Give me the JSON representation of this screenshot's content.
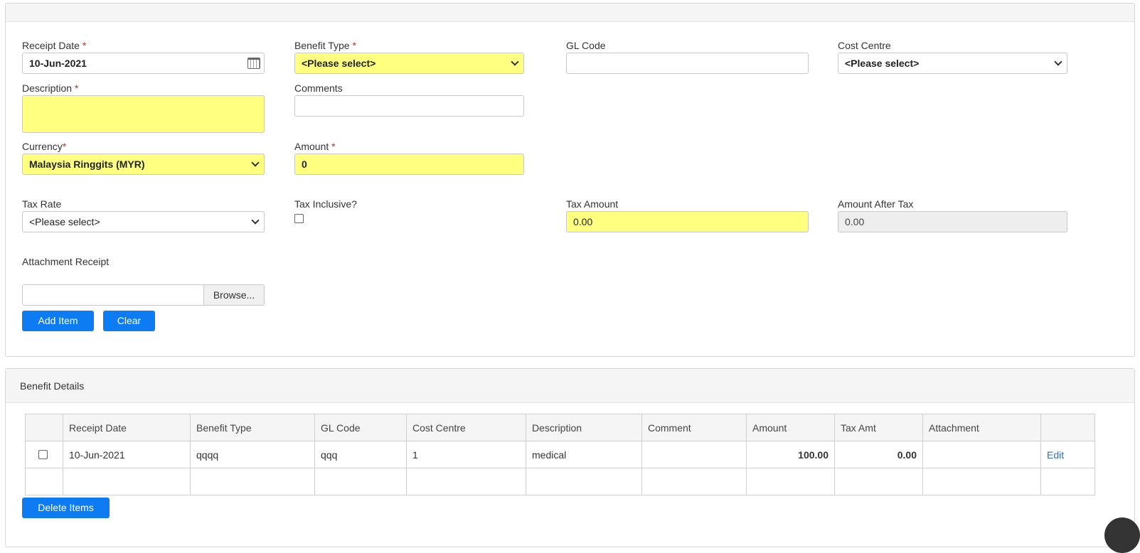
{
  "form": {
    "receipt_date_label": "Receipt Date",
    "receipt_date_value": "10-Jun-2021",
    "benefit_type_label": "Benefit Type",
    "benefit_type_value": "<Please select>",
    "gl_code_label": "GL Code",
    "gl_code_value": "",
    "cost_centre_label": "Cost Centre",
    "cost_centre_value": "<Please select>",
    "description_label": "Description",
    "description_value": "",
    "comments_label": "Comments",
    "comments_value": "",
    "currency_label": "Currency",
    "currency_value": "Malaysia Ringgits (MYR)",
    "amount_label": "Amount",
    "amount_value": "0",
    "tax_rate_label": "Tax Rate",
    "tax_rate_value": "<Please select>",
    "tax_inclusive_label": "Tax Inclusive?",
    "tax_amount_label": "Tax Amount",
    "tax_amount_value": "0.00",
    "amount_after_tax_label": "Amount After Tax",
    "amount_after_tax_value": "0.00",
    "attachment_label": "Attachment Receipt",
    "browse_label": "Browse...",
    "add_item_label": "Add Item",
    "clear_label": "Clear",
    "required_mark": "*"
  },
  "details": {
    "title": "Benefit Details",
    "columns": [
      "Receipt Date",
      "Benefit Type",
      "GL Code",
      "Cost Centre",
      "Description",
      "Comment",
      "Amount",
      "Tax Amt",
      "Attachment"
    ],
    "rows": [
      {
        "receipt_date": "10-Jun-2021",
        "benefit_type": "qqqq",
        "gl_code": "qqq",
        "cost_centre": "1",
        "description": "medical",
        "comment": "",
        "amount": "100.00",
        "tax_amt": "0.00",
        "attachment": "",
        "edit_label": "Edit"
      }
    ],
    "delete_label": "Delete Items"
  },
  "colors": {
    "required_field_bg": "#ffff80",
    "primary_button": "#0d7cf2",
    "link": "#2a6fc9"
  }
}
